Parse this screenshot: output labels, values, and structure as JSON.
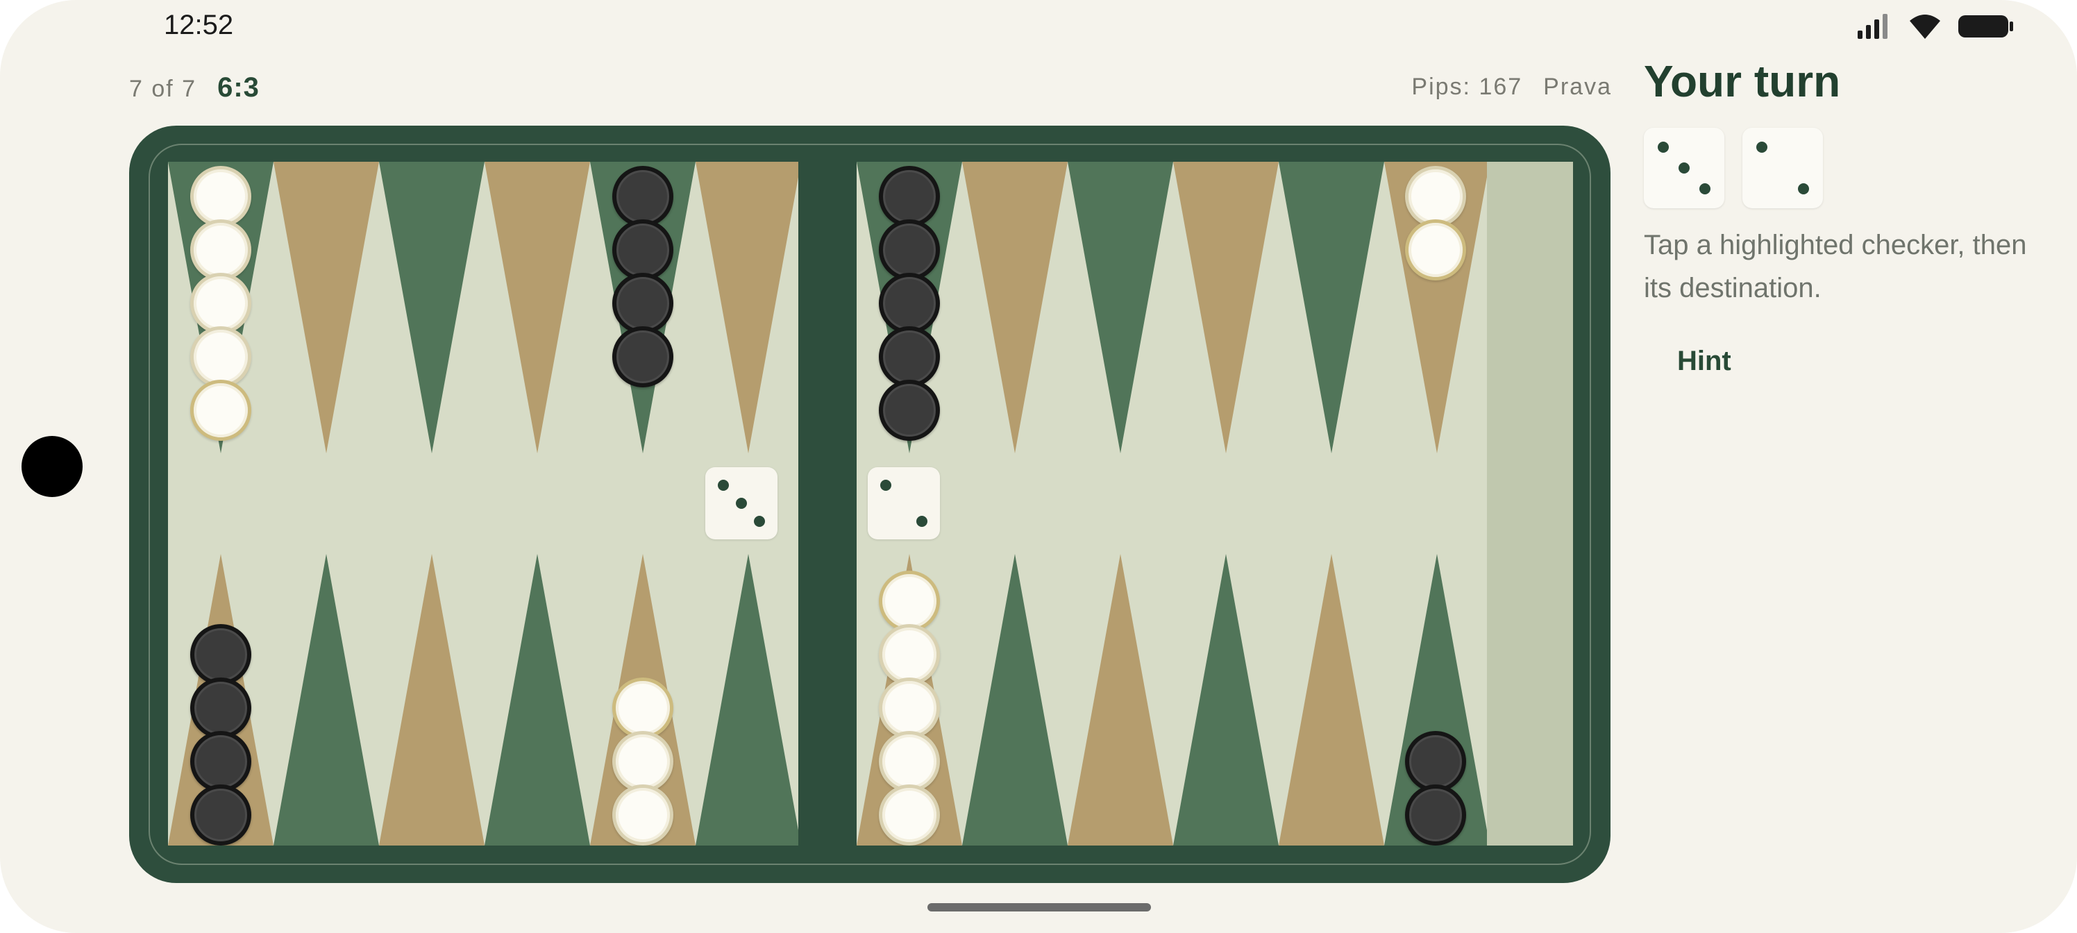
{
  "status": {
    "time": "12:52",
    "icons": [
      "signal-icon",
      "wifi-icon",
      "battery-icon"
    ]
  },
  "match": {
    "progress": "7 of 7",
    "score": "6:3",
    "pips": "Pips: 167",
    "opponent": "Prava"
  },
  "board_state": {
    "white_checkers_by_point": {
      "13": 5,
      "1": 2,
      "8": 3,
      "6": 5
    },
    "black_checkers_by_point": {
      "9": 4,
      "18": 5,
      "12": 4,
      "19": 2
    },
    "highlighted": [
      "white-13-top",
      "white-1-top",
      "white-8-top",
      "white-6-top"
    ],
    "board_dice": [
      3,
      2
    ]
  },
  "panel": {
    "title": "Your turn",
    "dice": [
      3,
      2
    ],
    "instructions": "Tap a highlighted checker, then its destination.",
    "hint_label": "Hint"
  },
  "colors": {
    "frame": "#2e4e3d",
    "felt": "#d7dcc7",
    "point_green": "#517559",
    "point_tan": "#b59d6e",
    "accent_text": "#284a36"
  }
}
